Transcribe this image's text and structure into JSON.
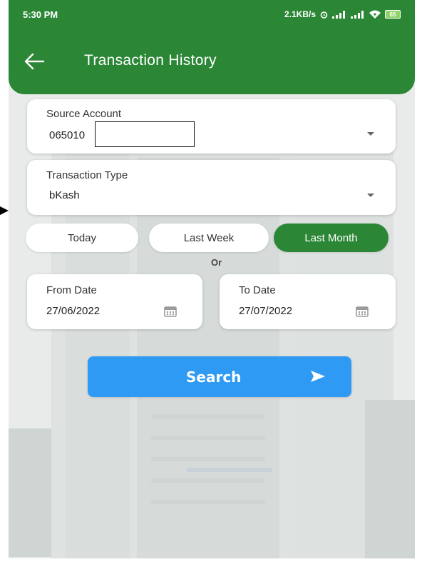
{
  "status_bar": {
    "time": "5:30 PM",
    "network_speed": "2.1KB/s",
    "battery_level": "65"
  },
  "app_bar": {
    "title": "Transaction History",
    "back_icon": "arrow-left-icon"
  },
  "source_account": {
    "label": "Source Account",
    "value": "065010"
  },
  "transaction_type": {
    "label": "Transaction Type",
    "value": "bKash"
  },
  "quick_range": {
    "options": [
      "Today",
      "Last Week",
      "Last Month"
    ],
    "selected": "Last Month"
  },
  "separator": "Or",
  "from_date": {
    "label": "From Date",
    "value": "27/06/2022"
  },
  "to_date": {
    "label": "To Date",
    "value": "27/07/2022"
  },
  "search_button": {
    "label": "Search",
    "icon": "send-arrow-icon"
  },
  "colors": {
    "primary_green": "#2b8736",
    "search_blue": "#2f9af3",
    "calendar_icon": "#9a9a9a"
  }
}
